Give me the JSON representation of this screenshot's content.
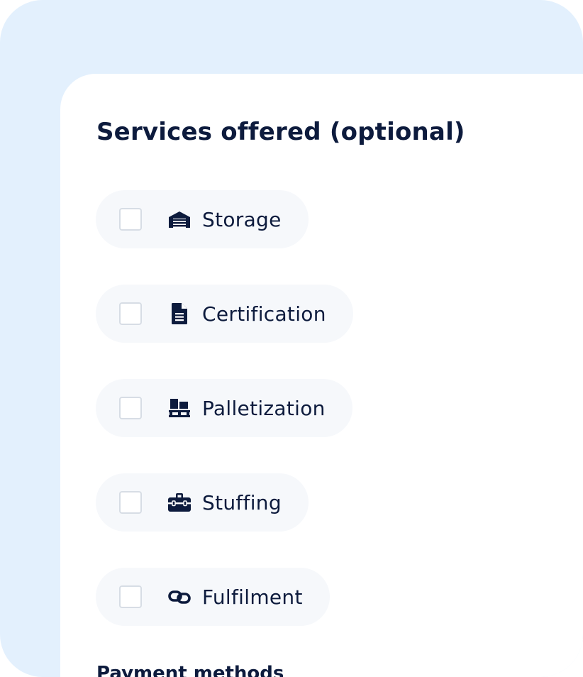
{
  "form": {
    "title": "Services offered (optional)",
    "options": [
      {
        "label": "Storage",
        "icon": "warehouse-icon",
        "checked": false
      },
      {
        "label": "Certification",
        "icon": "document-icon",
        "checked": false
      },
      {
        "label": "Palletization",
        "icon": "pallet-boxes-icon",
        "checked": false
      },
      {
        "label": "Stuffing",
        "icon": "toolbox-icon",
        "checked": false
      },
      {
        "label": "Fulfilment",
        "icon": "link-icon",
        "checked": false
      }
    ],
    "next_section_title": "Payment methods"
  },
  "colors": {
    "background": "#e3f0fd",
    "card": "#ffffff",
    "text": "#0d1b3d",
    "pill": "#f6f8fb",
    "checkbox_border": "#d7dde5"
  }
}
